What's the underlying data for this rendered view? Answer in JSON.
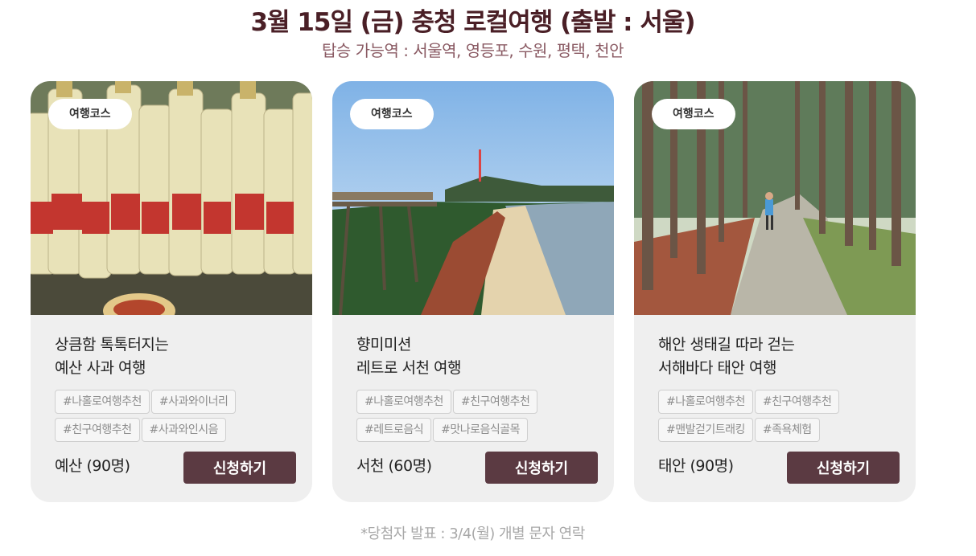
{
  "header": {
    "title": "3월 15일 (금) 충청 로컬여행 (출발 : 서울)",
    "subtitle": "탑승 가능역 :  서울역, 영등포, 수원, 평택, 천안"
  },
  "cards": [
    {
      "badge": "여행코스",
      "title_line1": "상큼함 톡톡터지는",
      "title_line2": "예산 사과 여행",
      "tags": [
        "#나홀로여행추천",
        "#사과와이너리",
        "#친구여행추천",
        "#사과와인시음"
      ],
      "region": "예산 (90명)",
      "button": "신청하기"
    },
    {
      "badge": "여행코스",
      "title_line1": "향미미션",
      "title_line2": "레트로 서천 여행",
      "tags": [
        "#나홀로여행추천",
        "#친구여행추천",
        "#레트로음식",
        "#맛나로음식골목"
      ],
      "region": "서천 (60명)",
      "button": "신청하기"
    },
    {
      "badge": "여행코스",
      "title_line1": "해안 생태길 따라 걷는",
      "title_line2": "서해바다 태안 여행",
      "tags": [
        "#나홀로여행추천",
        "#친구여행추천",
        "#맨발걷기트래킹",
        "#족욕체험"
      ],
      "region": "태안 (90명)",
      "button": "신청하기"
    }
  ],
  "footnote": "*당첨자 발표 : 3/4(월) 개별 문자 연락"
}
